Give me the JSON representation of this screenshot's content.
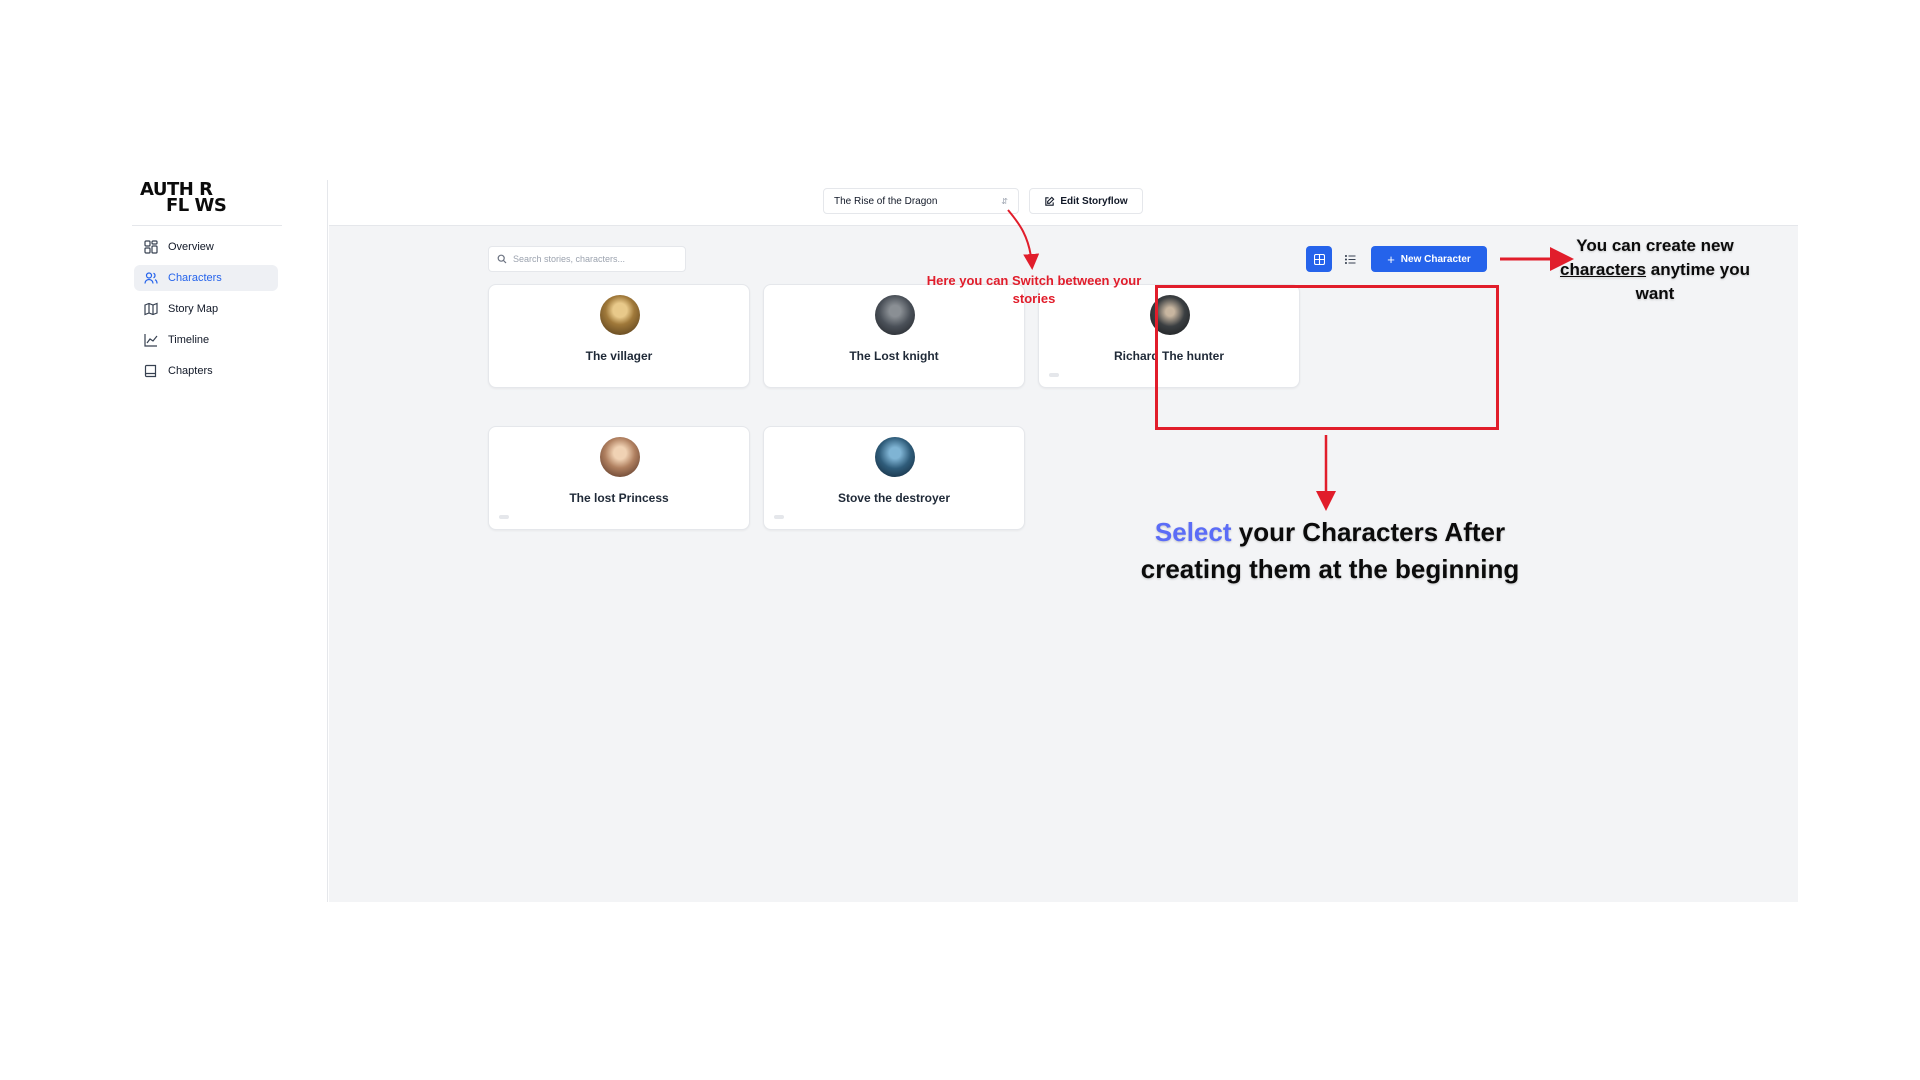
{
  "logo": {
    "line1": "AUTH R",
    "line2": "FL WS"
  },
  "sidebar": {
    "items": [
      {
        "label": "Overview",
        "icon": "grid-icon"
      },
      {
        "label": "Characters",
        "icon": "users-icon",
        "active": true
      },
      {
        "label": "Story Map",
        "icon": "map-icon"
      },
      {
        "label": "Timeline",
        "icon": "chart-line-icon"
      },
      {
        "label": "Chapters",
        "icon": "book-icon"
      }
    ]
  },
  "topbar": {
    "story_select": "The Rise of the Dragon",
    "edit_label": "Edit Storyflow"
  },
  "toolbar": {
    "search_placeholder": "Search stories, characters...",
    "new_label": "New Character",
    "active_view": "grid"
  },
  "characters": [
    {
      "name": "The villager",
      "avatar_color": "#a0793a"
    },
    {
      "name": "The Lost knight",
      "avatar_color": "#4a5058"
    },
    {
      "name": "Richard The hunter",
      "avatar_color": "#3b3f42"
    },
    {
      "name": "The lost Princess",
      "avatar_color": "#b08060"
    },
    {
      "name": "Stove the destroyer",
      "avatar_color": "#2f5c7a"
    }
  ],
  "annotations": {
    "story_hint": "Here you can Switch between your stories",
    "new_hint_a": "You can create new",
    "new_hint_b": "characters",
    "new_hint_c": "anytime you want",
    "select_hint_a": "Select",
    "select_hint_b": "your Characters After creating them at the beginning"
  },
  "colors": {
    "accent": "#2563eb",
    "annotation_red": "#e11d2b",
    "select_highlight": "#5b6cf7",
    "main_bg": "#f3f4f6"
  }
}
